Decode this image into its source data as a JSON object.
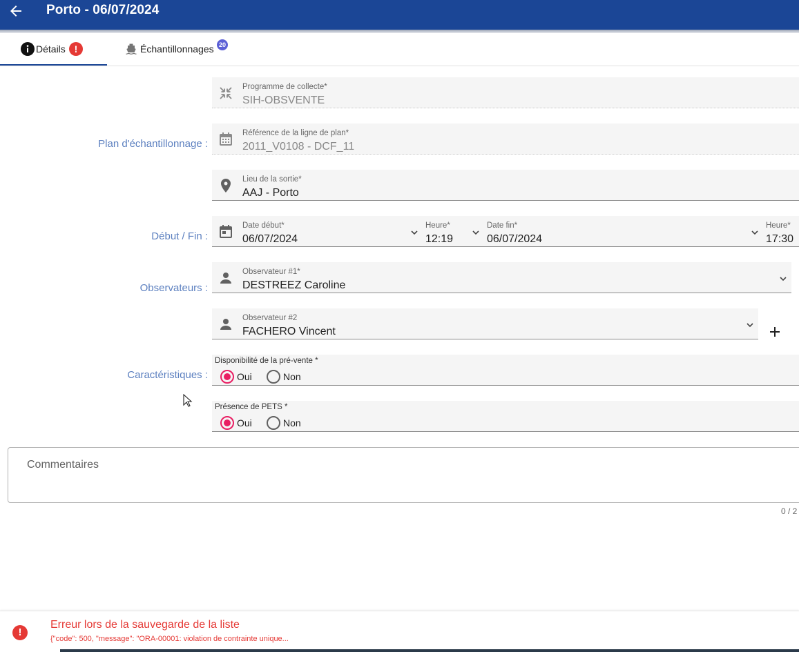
{
  "header": {
    "title": "Porto - 06/07/2024",
    "back_icon": "arrow-left-icon",
    "color": "#1b4696"
  },
  "tabs": [
    {
      "label": "Détails",
      "icon": "info-icon",
      "badge_icon": "alert-icon",
      "badge": "!",
      "active": true
    },
    {
      "label": "Échantillonnages",
      "icon": "boat-icon",
      "badge": "20",
      "active": false
    }
  ],
  "labels": {
    "plan": "Plan d'échantillonnage :",
    "dates": "Début / Fin :",
    "observers": "Observateurs :",
    "characteristics": "Caractéristiques :"
  },
  "fields": {
    "program": {
      "label": "Programme de collecte*",
      "value": "SIH-OBSVENTE",
      "icon": "compress-icon"
    },
    "plan_ref": {
      "label": "Référence de la ligne de plan*",
      "value": "2011_V0108 - DCF_11",
      "icon": "calendar-grid-icon"
    },
    "location": {
      "label": "Lieu de la sortie*",
      "value": "AAJ - Porto",
      "icon": "location-pin-icon"
    },
    "start_date": {
      "label": "Date début*",
      "value": "06/07/2024",
      "icon": "calendar-icon"
    },
    "start_time": {
      "label": "Heure*",
      "value": "12:19"
    },
    "end_date": {
      "label": "Date fin*",
      "value": "06/07/2024"
    },
    "end_time": {
      "label": "Heure*",
      "value": "17:30"
    },
    "observer1": {
      "label": "Observateur #1*",
      "value": "DESTREEZ Caroline",
      "icon": "person-icon"
    },
    "observer2": {
      "label": "Observateur #2",
      "value": "FACHERO Vincent",
      "icon": "person-icon"
    }
  },
  "radios": {
    "presale": {
      "label": "Disponibilité de la pré-vente *",
      "yes": "Oui",
      "no": "Non",
      "selected": "Oui"
    },
    "pets": {
      "label": "Présence de PETS *",
      "yes": "Oui",
      "no": "Non",
      "selected": "Oui"
    }
  },
  "comments": {
    "placeholder": "Commentaires",
    "counter": "0 / 2"
  },
  "error": {
    "title": "Erreur lors de la sauvegarde de la liste",
    "message": "{\"code\": 500, \"message\": \"ORA-00001: violation de contrainte unique...",
    "color": "#e53935"
  },
  "accent": "#e91e63"
}
